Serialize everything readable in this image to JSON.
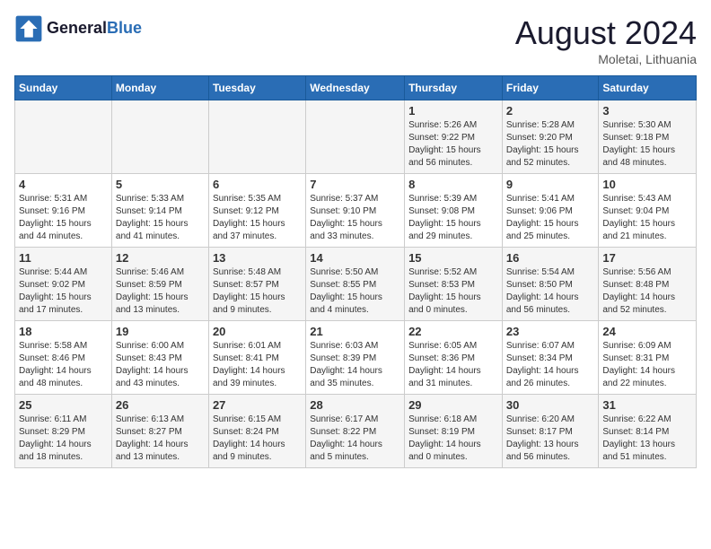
{
  "header": {
    "logo_line1": "General",
    "logo_line2": "Blue",
    "month": "August 2024",
    "location": "Moletai, Lithuania"
  },
  "weekdays": [
    "Sunday",
    "Monday",
    "Tuesday",
    "Wednesday",
    "Thursday",
    "Friday",
    "Saturday"
  ],
  "weeks": [
    [
      {
        "day": "",
        "info": ""
      },
      {
        "day": "",
        "info": ""
      },
      {
        "day": "",
        "info": ""
      },
      {
        "day": "",
        "info": ""
      },
      {
        "day": "1",
        "info": "Sunrise: 5:26 AM\nSunset: 9:22 PM\nDaylight: 15 hours\nand 56 minutes."
      },
      {
        "day": "2",
        "info": "Sunrise: 5:28 AM\nSunset: 9:20 PM\nDaylight: 15 hours\nand 52 minutes."
      },
      {
        "day": "3",
        "info": "Sunrise: 5:30 AM\nSunset: 9:18 PM\nDaylight: 15 hours\nand 48 minutes."
      }
    ],
    [
      {
        "day": "4",
        "info": "Sunrise: 5:31 AM\nSunset: 9:16 PM\nDaylight: 15 hours\nand 44 minutes."
      },
      {
        "day": "5",
        "info": "Sunrise: 5:33 AM\nSunset: 9:14 PM\nDaylight: 15 hours\nand 41 minutes."
      },
      {
        "day": "6",
        "info": "Sunrise: 5:35 AM\nSunset: 9:12 PM\nDaylight: 15 hours\nand 37 minutes."
      },
      {
        "day": "7",
        "info": "Sunrise: 5:37 AM\nSunset: 9:10 PM\nDaylight: 15 hours\nand 33 minutes."
      },
      {
        "day": "8",
        "info": "Sunrise: 5:39 AM\nSunset: 9:08 PM\nDaylight: 15 hours\nand 29 minutes."
      },
      {
        "day": "9",
        "info": "Sunrise: 5:41 AM\nSunset: 9:06 PM\nDaylight: 15 hours\nand 25 minutes."
      },
      {
        "day": "10",
        "info": "Sunrise: 5:43 AM\nSunset: 9:04 PM\nDaylight: 15 hours\nand 21 minutes."
      }
    ],
    [
      {
        "day": "11",
        "info": "Sunrise: 5:44 AM\nSunset: 9:02 PM\nDaylight: 15 hours\nand 17 minutes."
      },
      {
        "day": "12",
        "info": "Sunrise: 5:46 AM\nSunset: 8:59 PM\nDaylight: 15 hours\nand 13 minutes."
      },
      {
        "day": "13",
        "info": "Sunrise: 5:48 AM\nSunset: 8:57 PM\nDaylight: 15 hours\nand 9 minutes."
      },
      {
        "day": "14",
        "info": "Sunrise: 5:50 AM\nSunset: 8:55 PM\nDaylight: 15 hours\nand 4 minutes."
      },
      {
        "day": "15",
        "info": "Sunrise: 5:52 AM\nSunset: 8:53 PM\nDaylight: 15 hours\nand 0 minutes."
      },
      {
        "day": "16",
        "info": "Sunrise: 5:54 AM\nSunset: 8:50 PM\nDaylight: 14 hours\nand 56 minutes."
      },
      {
        "day": "17",
        "info": "Sunrise: 5:56 AM\nSunset: 8:48 PM\nDaylight: 14 hours\nand 52 minutes."
      }
    ],
    [
      {
        "day": "18",
        "info": "Sunrise: 5:58 AM\nSunset: 8:46 PM\nDaylight: 14 hours\nand 48 minutes."
      },
      {
        "day": "19",
        "info": "Sunrise: 6:00 AM\nSunset: 8:43 PM\nDaylight: 14 hours\nand 43 minutes."
      },
      {
        "day": "20",
        "info": "Sunrise: 6:01 AM\nSunset: 8:41 PM\nDaylight: 14 hours\nand 39 minutes."
      },
      {
        "day": "21",
        "info": "Sunrise: 6:03 AM\nSunset: 8:39 PM\nDaylight: 14 hours\nand 35 minutes."
      },
      {
        "day": "22",
        "info": "Sunrise: 6:05 AM\nSunset: 8:36 PM\nDaylight: 14 hours\nand 31 minutes."
      },
      {
        "day": "23",
        "info": "Sunrise: 6:07 AM\nSunset: 8:34 PM\nDaylight: 14 hours\nand 26 minutes."
      },
      {
        "day": "24",
        "info": "Sunrise: 6:09 AM\nSunset: 8:31 PM\nDaylight: 14 hours\nand 22 minutes."
      }
    ],
    [
      {
        "day": "25",
        "info": "Sunrise: 6:11 AM\nSunset: 8:29 PM\nDaylight: 14 hours\nand 18 minutes."
      },
      {
        "day": "26",
        "info": "Sunrise: 6:13 AM\nSunset: 8:27 PM\nDaylight: 14 hours\nand 13 minutes."
      },
      {
        "day": "27",
        "info": "Sunrise: 6:15 AM\nSunset: 8:24 PM\nDaylight: 14 hours\nand 9 minutes."
      },
      {
        "day": "28",
        "info": "Sunrise: 6:17 AM\nSunset: 8:22 PM\nDaylight: 14 hours\nand 5 minutes."
      },
      {
        "day": "29",
        "info": "Sunrise: 6:18 AM\nSunset: 8:19 PM\nDaylight: 14 hours\nand 0 minutes."
      },
      {
        "day": "30",
        "info": "Sunrise: 6:20 AM\nSunset: 8:17 PM\nDaylight: 13 hours\nand 56 minutes."
      },
      {
        "day": "31",
        "info": "Sunrise: 6:22 AM\nSunset: 8:14 PM\nDaylight: 13 hours\nand 51 minutes."
      }
    ]
  ]
}
